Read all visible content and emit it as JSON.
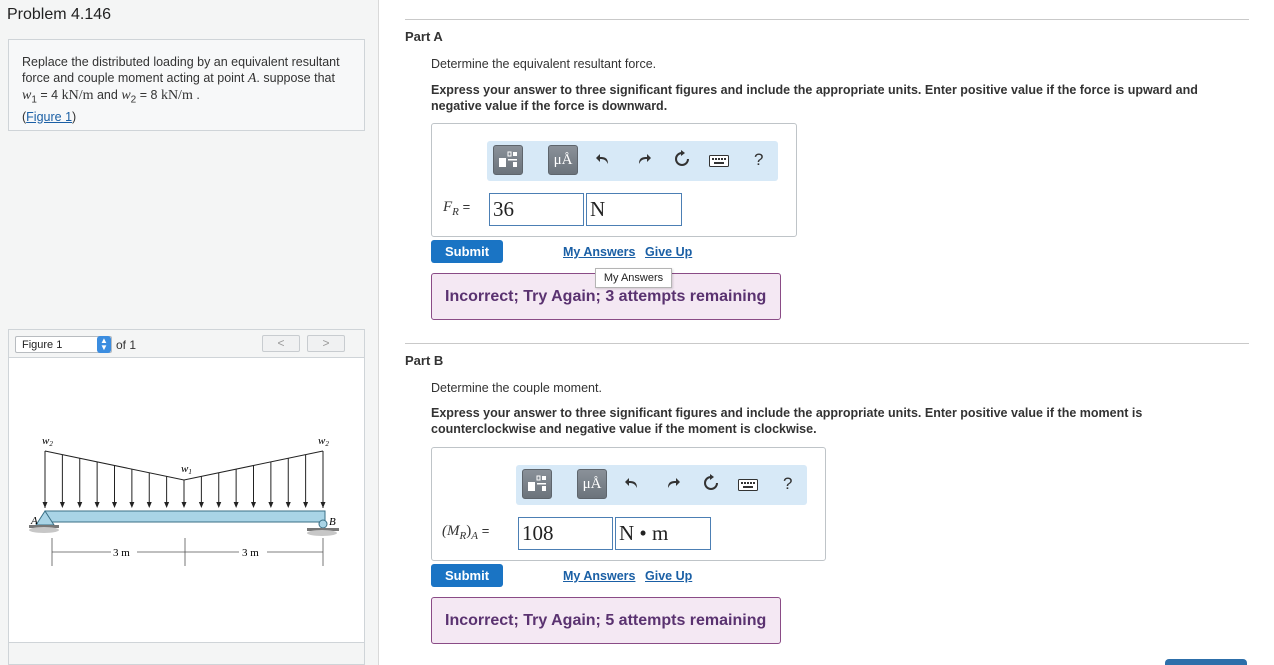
{
  "problem": {
    "title": "Problem 4.146",
    "text_1": "Replace the distributed loading by an equivalent resultant force and couple moment acting at point",
    "point": "A",
    "text_2": "suppose that",
    "w1_sym": "w",
    "w1_sub": "1",
    "w1_val": "= 4",
    "unit_1": "kN/m",
    "and": "and",
    "w2_sym": "w",
    "w2_sub": "2",
    "w2_val": "= 8",
    "unit_2": "kN/m",
    "end": ".",
    "figure_link": "Figure 1",
    "paren_open": "(",
    "paren_close": ")"
  },
  "figure_panel": {
    "select_value": "Figure 1",
    "of_text": "of 1",
    "prev": "<",
    "next": ">",
    "labels": {
      "w2_left": "w",
      "w2_left_sub": "2",
      "w2_right": "w",
      "w2_right_sub": "2",
      "w1": "w",
      "w1_sub": "1",
      "A": "A",
      "B": "B",
      "dim_left": "3 m",
      "dim_right": "3 m"
    }
  },
  "part_a": {
    "label": "Part A",
    "question": "Determine the equivalent resultant force.",
    "instructions": "Express your answer to three significant figures and include the appropriate units. Enter positive value if the force is upward and negative value if the force is downward.",
    "var_symbol": "F",
    "var_sub": "R",
    "equals": "=",
    "value": "36",
    "unit": "N",
    "submit": "Submit",
    "my_answers": "My Answers",
    "give_up": "Give Up",
    "tooltip": "My Answers",
    "feedback": "Incorrect; Try Again; 3 attempts remaining"
  },
  "part_b": {
    "label": "Part B",
    "question": "Determine the couple moment.",
    "instructions": "Express your answer to three significant figures and include the appropriate units. Enter positive value if the moment is counterclockwise and negative value if the moment is clockwise.",
    "var_symbol": "(M",
    "var_sub": "R",
    "var_close": ")",
    "var_sub2": "A",
    "equals": "=",
    "value": "108",
    "unit": "N • m",
    "submit": "Submit",
    "my_answers": "My Answers",
    "give_up": "Give Up",
    "feedback": "Incorrect; Try Again; 5 attempts remaining"
  },
  "toolbar": {
    "templates": "templates-icon",
    "units": "μÅ",
    "undo": "undo-icon",
    "redo": "redo-icon",
    "reset": "reset-icon",
    "keyboard": "keyboard-icon",
    "help": "?"
  },
  "colors": {
    "submit_bg": "#1a74c4",
    "feedback_bg": "#f4e8f3",
    "feedback_border": "#8a4b86",
    "toolbar_bg": "#d7e9f7",
    "link": "#1a5fa5"
  }
}
